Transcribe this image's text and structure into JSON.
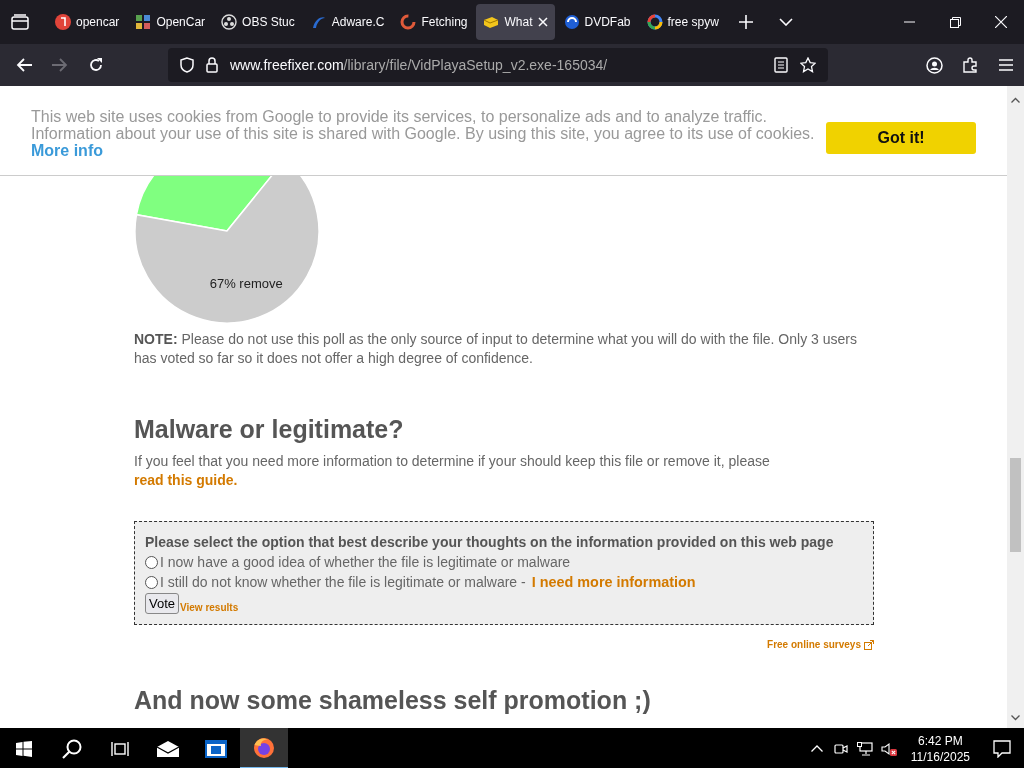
{
  "browser": {
    "tabs": [
      {
        "label": "opencar",
        "selected": false
      },
      {
        "label": "OpenCar",
        "selected": false
      },
      {
        "label": "OBS Stuc",
        "selected": false
      },
      {
        "label": "Adware.C",
        "selected": false
      },
      {
        "label": "Fetching",
        "selected": false
      },
      {
        "label": "What",
        "selected": true
      },
      {
        "label": "DVDFab",
        "selected": false
      },
      {
        "label": "free spyw",
        "selected": false
      }
    ],
    "address": {
      "host": "www.freefixer.com",
      "path": "/library/file/VidPlayaSetup_v2.exe-165034/"
    }
  },
  "cookie_banner": {
    "text_lines": [
      "This web site uses cookies from Google to provide its services, to personalize ads and to analyze traffic.",
      "Information about your use of this site is shared with Google. By using this site, you agree to its use of cookies."
    ],
    "more_info": "More info",
    "button": "Got it!"
  },
  "poll": {
    "chart_data": {
      "type": "pie",
      "values": [
        33,
        67
      ],
      "value_labels": [
        null,
        "67% remove"
      ]
    },
    "note": "**NOTE:** Please do not use this poll as the only source of input to determine what you will do with the file. Only 3 users has voted so far so it does not offer a high degree of confidence."
  },
  "malware_section": {
    "heading": "Malware or legitimate?",
    "intro": "If you feel that you need more information to determine if your should keep this file or remove it, please",
    "intro_link": "read this guide",
    "intro_end": ".",
    "survey": {
      "question": "Please select the option that best describe your thoughts on the information provided on this web page",
      "options": [
        {
          "label": "I now have a good idea of whether the file is legitimate or malware",
          "selected": false
        },
        {
          "label": "I still do not know whether the file is legitimate or malware -",
          "link": "I need more information",
          "selected": false
        }
      ],
      "vote_button": "Vote",
      "results_link": "View results"
    },
    "survey_credit": "Free online surveys"
  },
  "promo_heading": "And now some shameless self promotion ;)",
  "taskbar": {
    "time": "6:42 PM",
    "date": "11/16/2025"
  }
}
